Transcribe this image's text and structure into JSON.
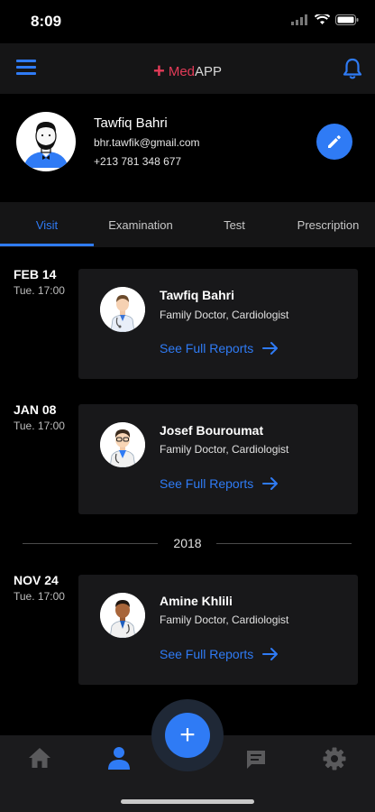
{
  "status": {
    "time": "8:09"
  },
  "header": {
    "brand_med": "Med",
    "brand_app": "APP"
  },
  "profile": {
    "name": "Tawfiq Bahri",
    "email": "bhr.tawfik@gmail.com",
    "phone": "+213 781 348 677"
  },
  "tabs": [
    {
      "label": "Visit"
    },
    {
      "label": "Examination"
    },
    {
      "label": "Test"
    },
    {
      "label": "Prescription"
    }
  ],
  "visits": [
    {
      "date": "FEB 14",
      "time": "Tue. 17:00",
      "doctor": "Tawfiq Bahri",
      "specialty": "Family Doctor, Cardiologist",
      "link": "See Full Reports"
    },
    {
      "date": "JAN 08",
      "time": "Tue. 17:00",
      "doctor": "Josef Bouroumat",
      "specialty": "Family Doctor, Cardiologist",
      "link": "See Full Reports"
    },
    {
      "date": "NOV 24",
      "time": "Tue. 17:00",
      "doctor": "Amine Khlili",
      "specialty": "Family Doctor, Cardiologist",
      "link": "See Full Reports"
    }
  ],
  "year_divider": "2018",
  "fab_symbol": "+",
  "colors": {
    "accent": "#2f7bf5",
    "brand": "#e33b58",
    "card": "#18181a",
    "bar": "#151516"
  },
  "icons": {
    "menu": "menu-icon",
    "bell": "bell-icon",
    "edit": "pencil-icon",
    "home": "home-icon",
    "profile": "user-icon",
    "chat": "chat-icon",
    "settings": "gear-icon"
  }
}
